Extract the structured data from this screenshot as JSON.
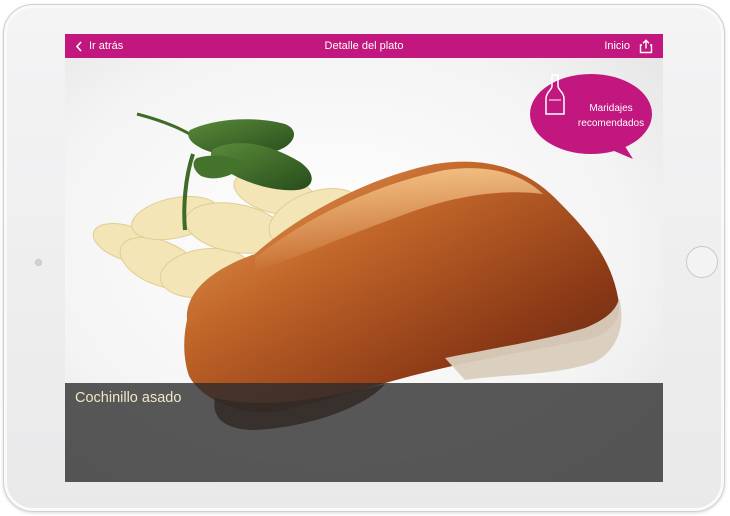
{
  "navbar": {
    "back_label": "Ir atrás",
    "title": "Detalle del plato",
    "home_label": "Inicio"
  },
  "pairing_bubble": {
    "line1": "Maridajes",
    "line2": "recomendados"
  },
  "dish": {
    "name": "Cochinillo asado"
  },
  "colors": {
    "accent": "#c2177e",
    "caption_text": "#f0e6c8"
  },
  "icons": [
    "chevron-left-icon",
    "share-icon",
    "wine-bottle-icon"
  ]
}
